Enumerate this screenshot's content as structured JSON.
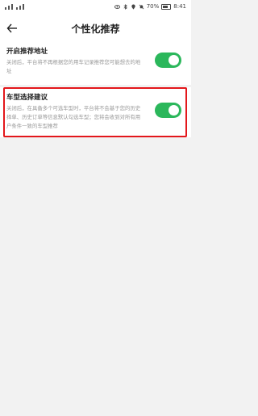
{
  "status_bar": {
    "battery_text": "70%",
    "time": "8:41"
  },
  "header": {
    "title": "个性化推荐",
    "back_icon": "arrow-left-icon"
  },
  "settings": [
    {
      "title": "开启推荐地址",
      "description": "关闭后，平台将不再根据您的用车记录推荐您可能想去的地址",
      "enabled": true
    },
    {
      "title": "车型选择建议",
      "description": "关闭后，在具备多个可选车型时，平台将不会基于您的历史择单、历史订单等信息默认勾选车型；您将会收到对所有用户条件一致的车型推荐",
      "enabled": true
    }
  ],
  "colors": {
    "toggle_on": "#2bb75b",
    "highlight": "#e3171b"
  }
}
